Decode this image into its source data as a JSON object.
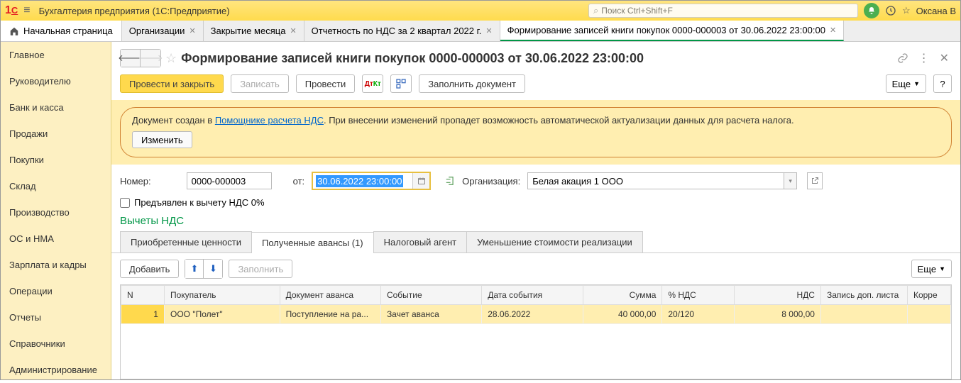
{
  "app": {
    "title": "Бухгалтерия предприятия  (1С:Предприятие)",
    "search_placeholder": "Поиск Ctrl+Shift+F",
    "username": "Оксана В"
  },
  "tabs": {
    "home": "Начальная страница",
    "items": [
      {
        "label": "Организации"
      },
      {
        "label": "Закрытие месяца"
      },
      {
        "label": "Отчетность по НДС за 2 квартал 2022 г."
      },
      {
        "label": "Формирование записей книги покупок 0000-000003 от 30.06.2022 23:00:00"
      }
    ]
  },
  "sidebar": {
    "items": [
      "Главное",
      "Руководителю",
      "Банк и касса",
      "Продажи",
      "Покупки",
      "Склад",
      "Производство",
      "ОС и НМА",
      "Зарплата и кадры",
      "Операции",
      "Отчеты",
      "Справочники",
      "Администрирование"
    ]
  },
  "doc": {
    "title": "Формирование записей книги покупок 0000-000003 от 30.06.2022 23:00:00",
    "toolbar": {
      "post_close": "Провести и закрыть",
      "save": "Записать",
      "post": "Провести",
      "fill_doc": "Заполнить документ",
      "more": "Еще"
    },
    "banner": {
      "prefix": "Документ создан в ",
      "link": "Помощнике расчета НДС",
      "suffix": ". При внесении изменений пропадет возможность автоматической актуализации данных для расчета налога.",
      "change_btn": "Изменить"
    },
    "form": {
      "number_label": "Номер:",
      "number_value": "0000-000003",
      "date_label": "от:",
      "date_value": "30.06.2022 23:00:00",
      "org_label": "Организация:",
      "org_value": "Белая акация 1 ООО",
      "checkbox_label": "Предъявлен к вычету НДС 0%"
    },
    "section_title": "Вычеты НДС",
    "inner_tabs": [
      "Приобретенные ценности",
      "Полученные авансы (1)",
      "Налоговый агент",
      "Уменьшение стоимости реализации"
    ],
    "table_toolbar": {
      "add": "Добавить",
      "fill": "Заполнить",
      "more": "Еще"
    },
    "table": {
      "columns": [
        "N",
        "Покупатель",
        "Документ аванса",
        "Событие",
        "Дата события",
        "Сумма",
        "% НДС",
        "НДС",
        "Запись доп. листа",
        "Корре"
      ],
      "rows": [
        {
          "n": "1",
          "buyer": "ООО \"Полет\"",
          "advance_doc": "Поступление на ра...",
          "event": "Зачет аванса",
          "event_date": "28.06.2022",
          "sum": "40 000,00",
          "vat_rate": "20/120",
          "vat": "8 000,00",
          "add_sheet": "",
          "corr": ""
        }
      ]
    }
  }
}
